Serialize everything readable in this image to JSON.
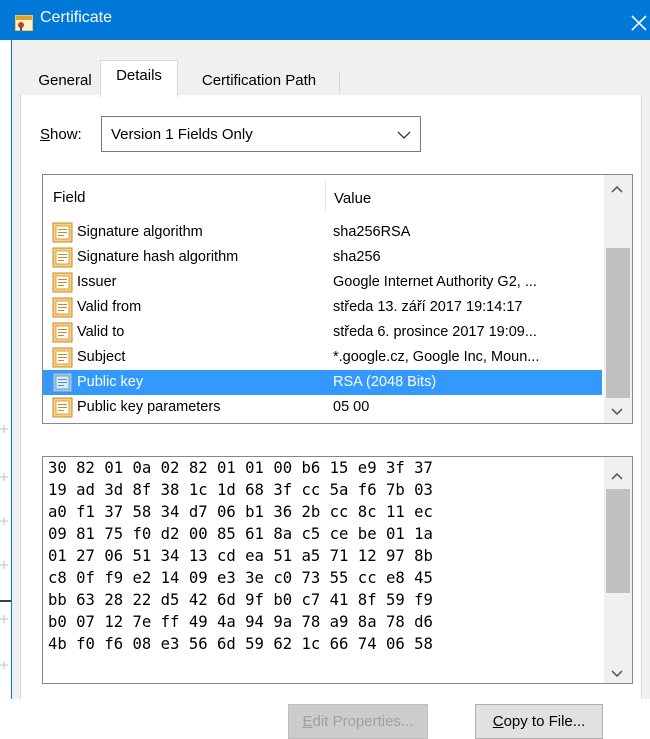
{
  "window": {
    "title": "Certificate"
  },
  "tabs": [
    {
      "label": "General",
      "active": false
    },
    {
      "label": "Details",
      "active": true
    },
    {
      "label": "Certification Path",
      "active": false
    }
  ],
  "show": {
    "label_accel": "S",
    "label_rest": "how:",
    "selected": "Version 1 Fields Only"
  },
  "fields": {
    "columns": [
      "Field",
      "Value"
    ],
    "rows": [
      {
        "name": "Signature algorithm",
        "value": "sha256RSA"
      },
      {
        "name": "Signature hash algorithm",
        "value": "sha256"
      },
      {
        "name": "Issuer",
        "value": "Google Internet Authority G2, ..."
      },
      {
        "name": "Valid from",
        "value": "středa 13. září 2017 19:14:17"
      },
      {
        "name": "Valid to",
        "value": "středa 6. prosince 2017 19:09..."
      },
      {
        "name": "Subject",
        "value": "*.google.cz, Google Inc, Moun..."
      },
      {
        "name": "Public key",
        "value": "RSA (2048 Bits)",
        "selected": true
      },
      {
        "name": "Public key parameters",
        "value": "05 00"
      }
    ]
  },
  "hex": [
    "30 82 01 0a 02 82 01 01 00 b6 15 e9 3f 37",
    "19 ad 3d 8f 38 1c 1d 68 3f cc 5a f6 7b 03",
    "a0 f1 37 58 34 d7 06 b1 36 2b cc 8c 11 ec",
    "09 81 75 f0 d2 00 85 61 8a c5 ce be 01 1a",
    "01 27 06 51 34 13 cd ea 51 a5 71 12 97 8b",
    "c8 0f f9 e2 14 09 e3 3e c0 73 55 cc e8 45",
    "bb 63 28 22 d5 42 6d 9f b0 c7 41 8f 59 f9",
    "b0 07 12 7e ff 49 4a 94 9a 78 a9 8a 78 d6",
    "4b f0 f6 08 e3 56 6d 59 62 1c 66 74 06 58"
  ],
  "buttons": {
    "edit_accel": "E",
    "edit_rest": "dit Properties...",
    "copy_accel": "C",
    "copy_rest": "opy to File..."
  },
  "colors": {
    "titlebar": "#0078d7",
    "selection": "#3399ff"
  },
  "icons": {
    "app": "certificate-icon",
    "close": "close-icon",
    "field": "field-document-icon"
  }
}
